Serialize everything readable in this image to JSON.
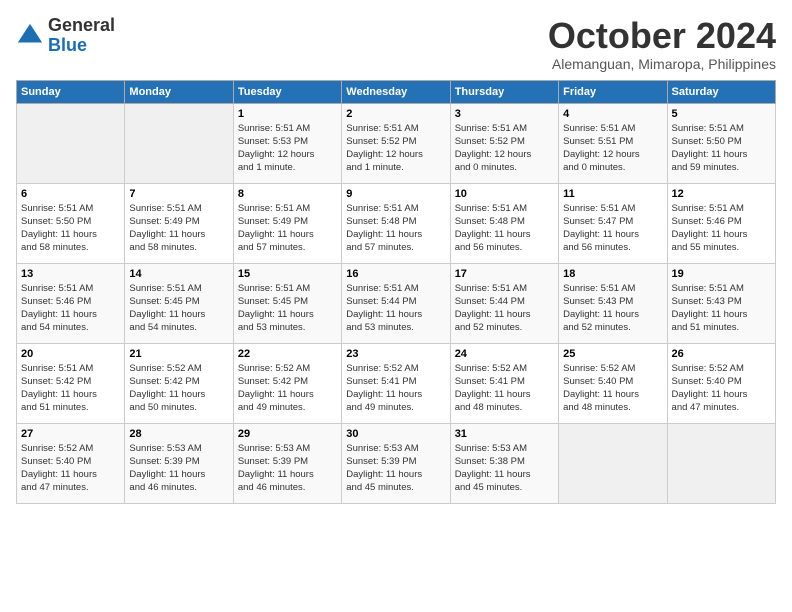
{
  "header": {
    "logo_general": "General",
    "logo_blue": "Blue",
    "month_title": "October 2024",
    "location": "Alemanguan, Mimaropa, Philippines"
  },
  "calendar": {
    "days_of_week": [
      "Sunday",
      "Monday",
      "Tuesday",
      "Wednesday",
      "Thursday",
      "Friday",
      "Saturday"
    ],
    "weeks": [
      [
        {
          "day": "",
          "detail": ""
        },
        {
          "day": "",
          "detail": ""
        },
        {
          "day": "1",
          "detail": "Sunrise: 5:51 AM\nSunset: 5:53 PM\nDaylight: 12 hours\nand 1 minute."
        },
        {
          "day": "2",
          "detail": "Sunrise: 5:51 AM\nSunset: 5:52 PM\nDaylight: 12 hours\nand 1 minute."
        },
        {
          "day": "3",
          "detail": "Sunrise: 5:51 AM\nSunset: 5:52 PM\nDaylight: 12 hours\nand 0 minutes."
        },
        {
          "day": "4",
          "detail": "Sunrise: 5:51 AM\nSunset: 5:51 PM\nDaylight: 12 hours\nand 0 minutes."
        },
        {
          "day": "5",
          "detail": "Sunrise: 5:51 AM\nSunset: 5:50 PM\nDaylight: 11 hours\nand 59 minutes."
        }
      ],
      [
        {
          "day": "6",
          "detail": "Sunrise: 5:51 AM\nSunset: 5:50 PM\nDaylight: 11 hours\nand 58 minutes."
        },
        {
          "day": "7",
          "detail": "Sunrise: 5:51 AM\nSunset: 5:49 PM\nDaylight: 11 hours\nand 58 minutes."
        },
        {
          "day": "8",
          "detail": "Sunrise: 5:51 AM\nSunset: 5:49 PM\nDaylight: 11 hours\nand 57 minutes."
        },
        {
          "day": "9",
          "detail": "Sunrise: 5:51 AM\nSunset: 5:48 PM\nDaylight: 11 hours\nand 57 minutes."
        },
        {
          "day": "10",
          "detail": "Sunrise: 5:51 AM\nSunset: 5:48 PM\nDaylight: 11 hours\nand 56 minutes."
        },
        {
          "day": "11",
          "detail": "Sunrise: 5:51 AM\nSunset: 5:47 PM\nDaylight: 11 hours\nand 56 minutes."
        },
        {
          "day": "12",
          "detail": "Sunrise: 5:51 AM\nSunset: 5:46 PM\nDaylight: 11 hours\nand 55 minutes."
        }
      ],
      [
        {
          "day": "13",
          "detail": "Sunrise: 5:51 AM\nSunset: 5:46 PM\nDaylight: 11 hours\nand 54 minutes."
        },
        {
          "day": "14",
          "detail": "Sunrise: 5:51 AM\nSunset: 5:45 PM\nDaylight: 11 hours\nand 54 minutes."
        },
        {
          "day": "15",
          "detail": "Sunrise: 5:51 AM\nSunset: 5:45 PM\nDaylight: 11 hours\nand 53 minutes."
        },
        {
          "day": "16",
          "detail": "Sunrise: 5:51 AM\nSunset: 5:44 PM\nDaylight: 11 hours\nand 53 minutes."
        },
        {
          "day": "17",
          "detail": "Sunrise: 5:51 AM\nSunset: 5:44 PM\nDaylight: 11 hours\nand 52 minutes."
        },
        {
          "day": "18",
          "detail": "Sunrise: 5:51 AM\nSunset: 5:43 PM\nDaylight: 11 hours\nand 52 minutes."
        },
        {
          "day": "19",
          "detail": "Sunrise: 5:51 AM\nSunset: 5:43 PM\nDaylight: 11 hours\nand 51 minutes."
        }
      ],
      [
        {
          "day": "20",
          "detail": "Sunrise: 5:51 AM\nSunset: 5:42 PM\nDaylight: 11 hours\nand 51 minutes."
        },
        {
          "day": "21",
          "detail": "Sunrise: 5:52 AM\nSunset: 5:42 PM\nDaylight: 11 hours\nand 50 minutes."
        },
        {
          "day": "22",
          "detail": "Sunrise: 5:52 AM\nSunset: 5:42 PM\nDaylight: 11 hours\nand 49 minutes."
        },
        {
          "day": "23",
          "detail": "Sunrise: 5:52 AM\nSunset: 5:41 PM\nDaylight: 11 hours\nand 49 minutes."
        },
        {
          "day": "24",
          "detail": "Sunrise: 5:52 AM\nSunset: 5:41 PM\nDaylight: 11 hours\nand 48 minutes."
        },
        {
          "day": "25",
          "detail": "Sunrise: 5:52 AM\nSunset: 5:40 PM\nDaylight: 11 hours\nand 48 minutes."
        },
        {
          "day": "26",
          "detail": "Sunrise: 5:52 AM\nSunset: 5:40 PM\nDaylight: 11 hours\nand 47 minutes."
        }
      ],
      [
        {
          "day": "27",
          "detail": "Sunrise: 5:52 AM\nSunset: 5:40 PM\nDaylight: 11 hours\nand 47 minutes."
        },
        {
          "day": "28",
          "detail": "Sunrise: 5:53 AM\nSunset: 5:39 PM\nDaylight: 11 hours\nand 46 minutes."
        },
        {
          "day": "29",
          "detail": "Sunrise: 5:53 AM\nSunset: 5:39 PM\nDaylight: 11 hours\nand 46 minutes."
        },
        {
          "day": "30",
          "detail": "Sunrise: 5:53 AM\nSunset: 5:39 PM\nDaylight: 11 hours\nand 45 minutes."
        },
        {
          "day": "31",
          "detail": "Sunrise: 5:53 AM\nSunset: 5:38 PM\nDaylight: 11 hours\nand 45 minutes."
        },
        {
          "day": "",
          "detail": ""
        },
        {
          "day": "",
          "detail": ""
        }
      ]
    ]
  }
}
